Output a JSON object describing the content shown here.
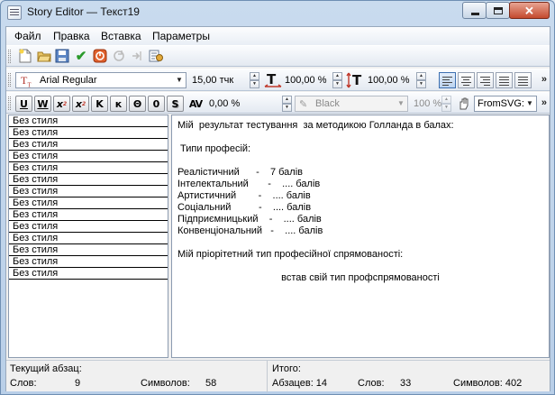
{
  "window": {
    "title": "Story Editor — Текст19",
    "close_glyph": "✕"
  },
  "menu": [
    "Файл",
    "Правка",
    "Вставка",
    "Параметры"
  ],
  "toolbar1": {
    "icons": [
      "new-document-icon",
      "open-folder-icon",
      "save-icon",
      "apply-check-icon",
      "cancel-icon",
      "refresh-icon",
      "export-icon",
      "properties-icon"
    ],
    "check_glyph": "✔"
  },
  "toolbar2": {
    "font": "Arial Regular",
    "font_size": "15,00 тчк",
    "hscale": "100,00 %",
    "vscale": "100,00 %",
    "overflow": "»"
  },
  "toolbar3": {
    "style_buttons": [
      "U",
      "W",
      "x",
      "x",
      "K",
      "к",
      "Θ",
      "0",
      "S"
    ],
    "tracking_label": "AV",
    "tracking": "0,00 %",
    "color": "Black",
    "shade": "100 %",
    "svg_preset": "FromSVG:",
    "overflow": "»"
  },
  "styles": [
    "Без стиля",
    "Без стиля",
    "Без стиля",
    "Без стиля",
    "Без стиля",
    "Без стиля",
    "Без стиля",
    "Без стиля",
    "Без стиля",
    "Без стиля",
    "Без стиля",
    "Без стиля",
    "Без стиля",
    "Без стиля"
  ],
  "text": [
    "Мій  результат тестування  за методикою Голланда в балах:",
    "",
    " Типи професій:",
    "",
    "Реалістичний      -    7 балів",
    "Інтелектальний       -    .... балів",
    "Артистичний        -    .... балів",
    "Соціальний          -    .... балів",
    "Підприємницький    -    .... балів",
    "Конвенціональний   -    .... балів",
    "",
    "Мій пріорітетний тип професійної спрямованості:",
    "",
    "встав свій тип профспрямованості"
  ],
  "status": {
    "current_paragraph_label": "Текущий абзац:",
    "words_label": "Слов:",
    "words_value": "9",
    "chars_label": "Символов:",
    "chars_value": "58",
    "total_label": "Итого:",
    "paragraphs_label": "Абзацев: 14",
    "total_words_label": "Слов:",
    "total_words_value": "33",
    "total_chars_label": "Символов: 402"
  }
}
